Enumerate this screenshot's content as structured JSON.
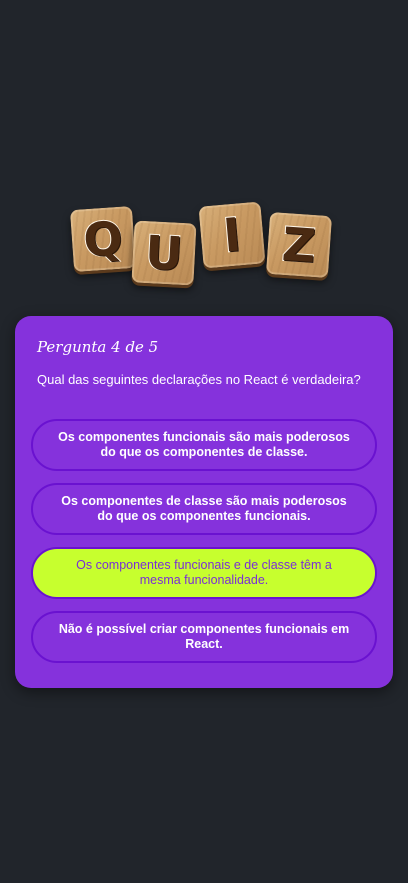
{
  "logo": {
    "letters": [
      "Q",
      "U",
      "I",
      "Z"
    ]
  },
  "quiz": {
    "counter": "Pergunta 4 de 5",
    "question": "Qual das seguintes declarações no React é verdadeira?",
    "answers": [
      {
        "label": "Os componentes funcionais são mais poderosos do que os componentes de classe.",
        "selected": false
      },
      {
        "label": "Os componentes de classe são mais poderosos do que os componentes funcionais.",
        "selected": false
      },
      {
        "label": "Os componentes funcionais e de classe têm a mesma funcionalidade.",
        "selected": true
      },
      {
        "label": "Não é possível criar componentes funcionais em React.",
        "selected": false
      }
    ]
  },
  "colors": {
    "background": "#21252b",
    "card": "#8532dc",
    "answer_border": "#6a12d0",
    "selected_answer": "#c7ff2e",
    "selected_text": "#7a2fd6"
  }
}
